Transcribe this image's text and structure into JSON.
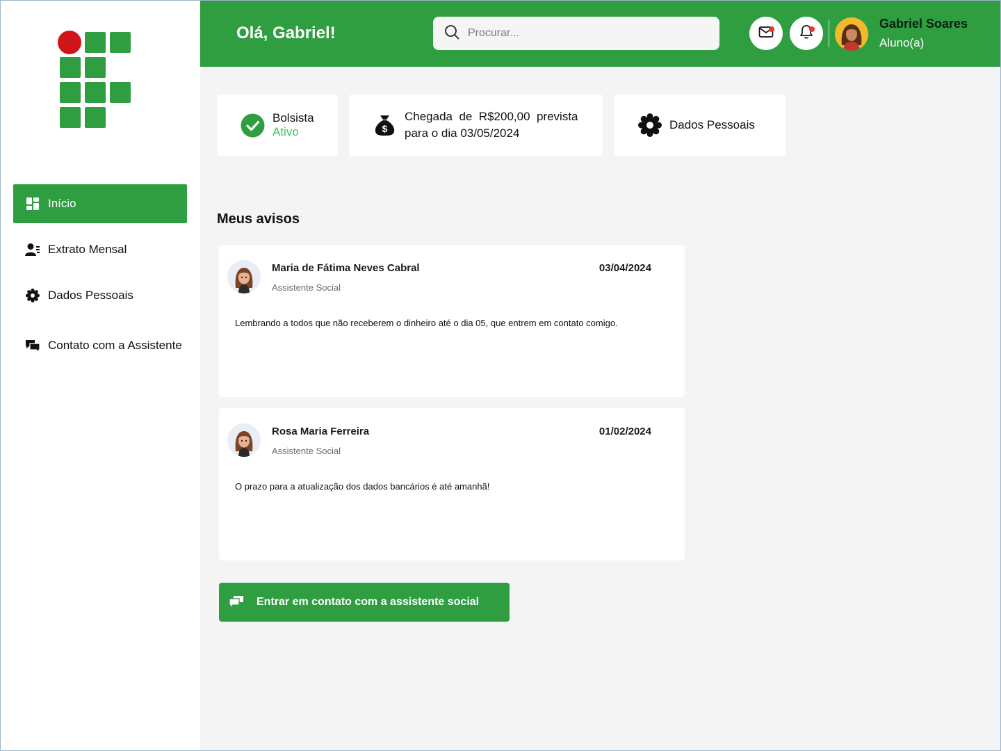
{
  "header": {
    "greeting": "Olá, Gabriel!",
    "search_placeholder": "Procurar...",
    "user_name": "Gabriel Soares",
    "user_role": "Aluno(a)"
  },
  "sidebar": {
    "items": [
      {
        "label": "Início",
        "icon": "dashboard-icon",
        "active": true
      },
      {
        "label": "Extrato Mensal",
        "icon": "user-list-icon",
        "active": false
      },
      {
        "label": "Dados Pessoais",
        "icon": "gear-icon",
        "active": false
      },
      {
        "label": "Contato com a Assistente",
        "icon": "chat-icon",
        "active": false
      }
    ]
  },
  "status_cards": {
    "bolsista_label": "Bolsista",
    "bolsista_status": "Ativo",
    "payment_line1": "Chegada  de  R$200,00  prevista",
    "payment_line2": "para o dia 03/05/2024",
    "personal_data_label": "Dados Pessoais"
  },
  "notices": {
    "title": "Meus avisos",
    "items": [
      {
        "author": "Maria de Fátima Neves Cabral",
        "role": "Assistente Social",
        "date": "03/04/2024",
        "message": "Lembrando a todos que não receberem o dinheiro até o dia 05, que entrem em contato comigo."
      },
      {
        "author": "Rosa Maria Ferreira",
        "role": "Assistente Social",
        "date": "01/02/2024",
        "message": "O prazo para a atualização dos dados bancários é até amanhã!"
      }
    ]
  },
  "cta": {
    "label": "Entrar em contato com a assistente social"
  },
  "colors": {
    "brand_green": "#2f9e41",
    "status_green": "#3cc05a",
    "logo_red": "#cf1518",
    "notification_red": "#e8372a"
  }
}
